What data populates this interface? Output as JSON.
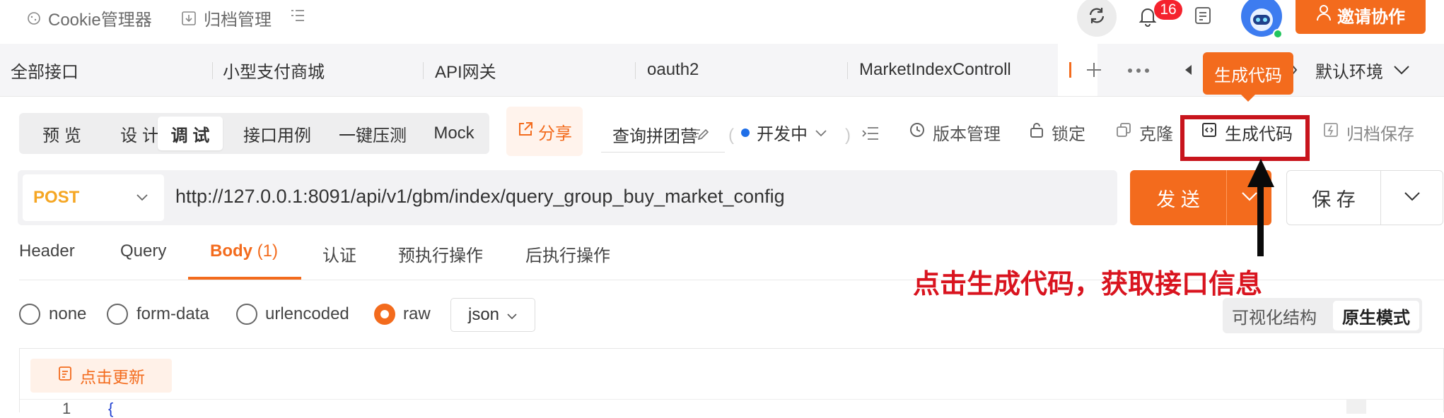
{
  "topbar": {
    "cookie_label": "Cookie管理器",
    "archive_label": "归档管理",
    "notification_count": "16",
    "invite_label": "邀请协作"
  },
  "tabs": [
    {
      "label": "全部接口"
    },
    {
      "label": "小型支付商城"
    },
    {
      "label": "API网关"
    },
    {
      "label": "oauth2"
    },
    {
      "label": "MarketIndexControll"
    }
  ],
  "environment": {
    "label": "默认环境"
  },
  "tooltip": {
    "label": "生成代码"
  },
  "segments": [
    {
      "label": "预 览"
    },
    {
      "label": "设 计"
    },
    {
      "label": "调 试"
    },
    {
      "label": "接口用例"
    },
    {
      "label": "一键压测"
    },
    {
      "label": "Mock"
    }
  ],
  "toolbar": {
    "share": "分享",
    "api_name": "查询拼团营",
    "status": "开发中",
    "version": "版本管理",
    "lock": "锁定",
    "clone": "克隆",
    "generate_code": "生成代码",
    "archive_save": "归档保存"
  },
  "request": {
    "method": "POST",
    "url": "http://127.0.0.1:8091/api/v1/gbm/index/query_group_buy_market_config",
    "send": "发 送",
    "save": "保 存"
  },
  "request_tabs": [
    {
      "label": "Header"
    },
    {
      "label": "Query"
    },
    {
      "label": "Body",
      "count": "(1)"
    },
    {
      "label": "认证"
    },
    {
      "label": "预执行操作"
    },
    {
      "label": "后执行操作"
    }
  ],
  "annotation": {
    "text": "点击生成代码，获取接口信息"
  },
  "body_types": [
    {
      "label": "none"
    },
    {
      "label": "form-data"
    },
    {
      "label": "urlencoded"
    },
    {
      "label": "raw"
    }
  ],
  "body_format": {
    "selected": "json"
  },
  "view_modes": {
    "visual": "可视化结构",
    "raw": "原生模式"
  },
  "editor": {
    "update_button": "点击更新",
    "line_number": "1",
    "first_line": "{"
  },
  "colors": {
    "accent": "#f36b1d",
    "annotation_red": "#d9141f",
    "status_dot": "#1f6fe8"
  }
}
